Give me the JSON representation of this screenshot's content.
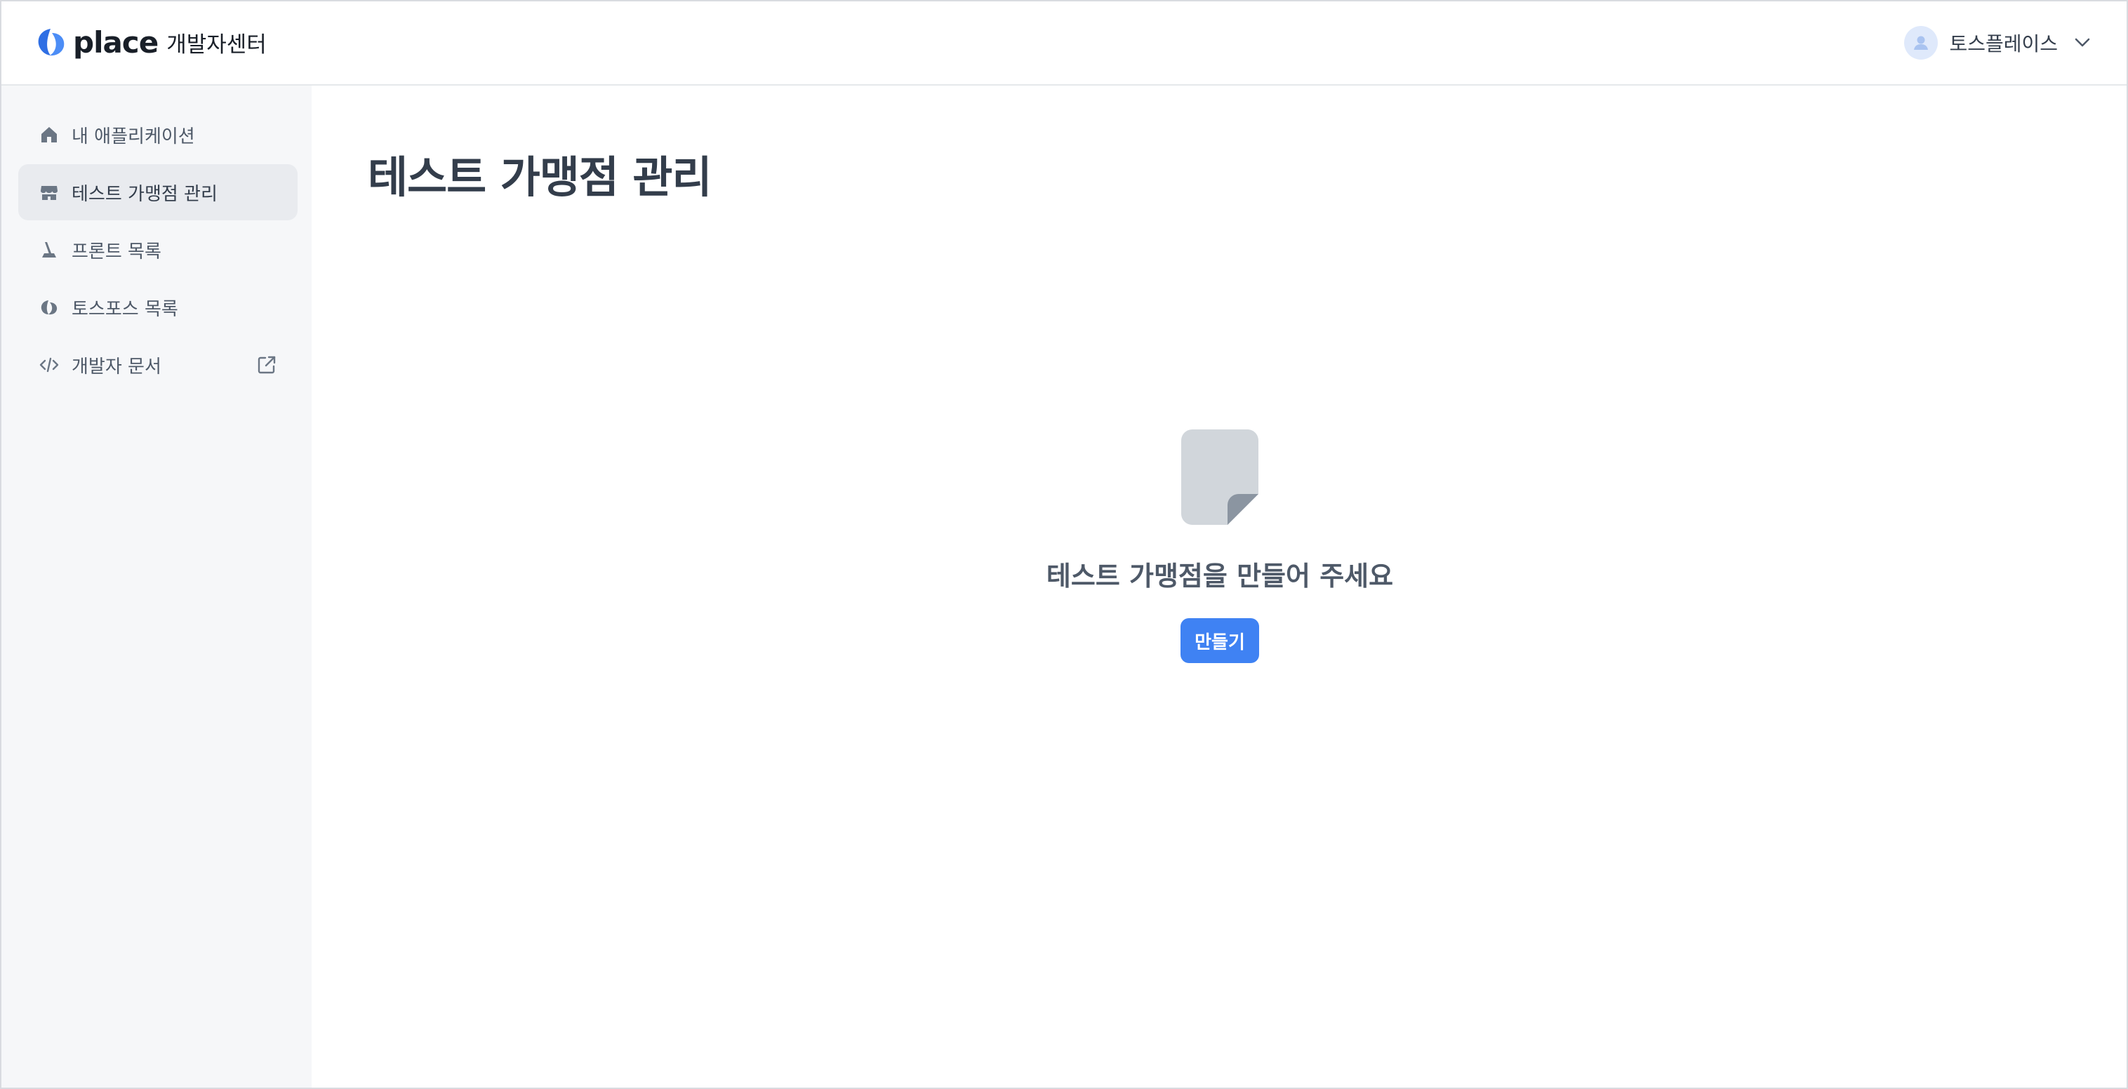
{
  "header": {
    "logo_word": "place",
    "logo_sub": "개발자센터",
    "user_name": "토스플레이스",
    "icons": {
      "logo": "place-logo-icon",
      "avatar": "user-avatar-icon",
      "menu": "chevron-down-icon"
    }
  },
  "sidebar": {
    "items": [
      {
        "label": "내 애플리케이션",
        "icon": "home-icon",
        "active": false
      },
      {
        "label": "테스트 가맹점 관리",
        "icon": "store-icon",
        "active": true
      },
      {
        "label": "프론트 목록",
        "icon": "front-device-icon",
        "active": false
      },
      {
        "label": "토스포스 목록",
        "icon": "toss-pos-icon",
        "active": false
      },
      {
        "label": "개발자 문서",
        "icon": "code-icon",
        "active": false,
        "external_icon": "external-link-icon"
      }
    ]
  },
  "main": {
    "title": "테스트 가맹점 관리",
    "empty_state": {
      "icon": "document-icon",
      "message": "테스트 가맹점을 만들어 주세요",
      "button_label": "만들기"
    }
  },
  "colors": {
    "accent": "#3f82f3",
    "sidebar_bg": "#f6f7f9",
    "active_item_bg": "#e9ebef",
    "title_text": "#333d4b",
    "icon_gray": "#8b95a1"
  }
}
